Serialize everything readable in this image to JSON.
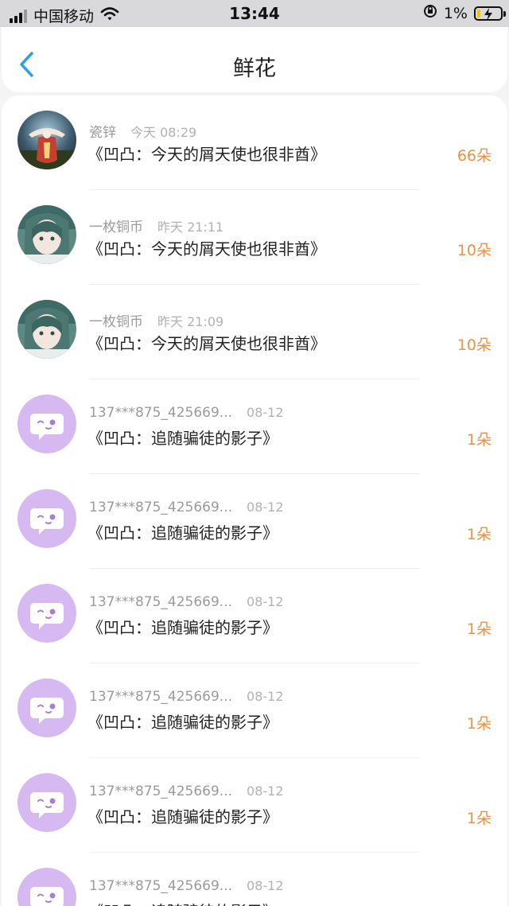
{
  "status_bar": {
    "carrier": "中国移动",
    "time": "13:44",
    "battery": "1%"
  },
  "nav": {
    "title": "鲜花",
    "back_icon": "chevron-left-icon"
  },
  "colors": {
    "accent": "#2fa0e8",
    "count": "#e8924a",
    "avatar_default": "#d7b9f1"
  },
  "items": [
    {
      "user": "瓷锌",
      "time": "今天 08:29",
      "title": "《凹凸：今天的屑天使也很非酋》",
      "count": "66朵",
      "avatar": "photo-avatar-1"
    },
    {
      "user": "一枚铜币",
      "time": "昨天 21:11",
      "title": "《凹凸：今天的屑天使也很非酋》",
      "count": "10朵",
      "avatar": "photo-avatar-2"
    },
    {
      "user": "一枚铜币",
      "time": "昨天 21:09",
      "title": "《凹凸：今天的屑天使也很非酋》",
      "count": "10朵",
      "avatar": "photo-avatar-2"
    },
    {
      "user": "137***875_425669...",
      "time": "08-12",
      "title": "《凹凸：追随骗徒的影子》",
      "count": "1朵",
      "avatar": "default-avatar"
    },
    {
      "user": "137***875_425669...",
      "time": "08-12",
      "title": "《凹凸：追随骗徒的影子》",
      "count": "1朵",
      "avatar": "default-avatar"
    },
    {
      "user": "137***875_425669...",
      "time": "08-12",
      "title": "《凹凸：追随骗徒的影子》",
      "count": "1朵",
      "avatar": "default-avatar"
    },
    {
      "user": "137***875_425669...",
      "time": "08-12",
      "title": "《凹凸：追随骗徒的影子》",
      "count": "1朵",
      "avatar": "default-avatar"
    },
    {
      "user": "137***875_425669...",
      "time": "08-12",
      "title": "《凹凸：追随骗徒的影子》",
      "count": "1朵",
      "avatar": "default-avatar"
    },
    {
      "user": "137***875_425669...",
      "time": "08-12",
      "title": "《凹凸：追随骗徒的影子》",
      "count": "",
      "avatar": "default-avatar"
    }
  ]
}
